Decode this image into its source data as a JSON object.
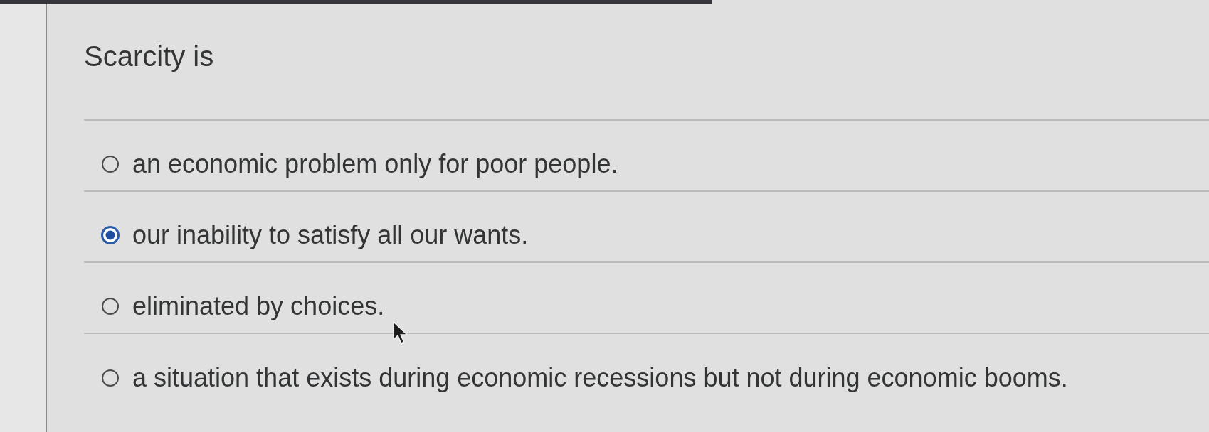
{
  "question": {
    "text": "Scarcity is"
  },
  "options": [
    {
      "label": "an economic problem only for poor people.",
      "selected": false
    },
    {
      "label": "our inability to satisfy all our wants.",
      "selected": true
    },
    {
      "label": "eliminated by choices.",
      "selected": false
    },
    {
      "label": "a situation that exists during economic recessions but not during economic booms.",
      "selected": false
    }
  ]
}
